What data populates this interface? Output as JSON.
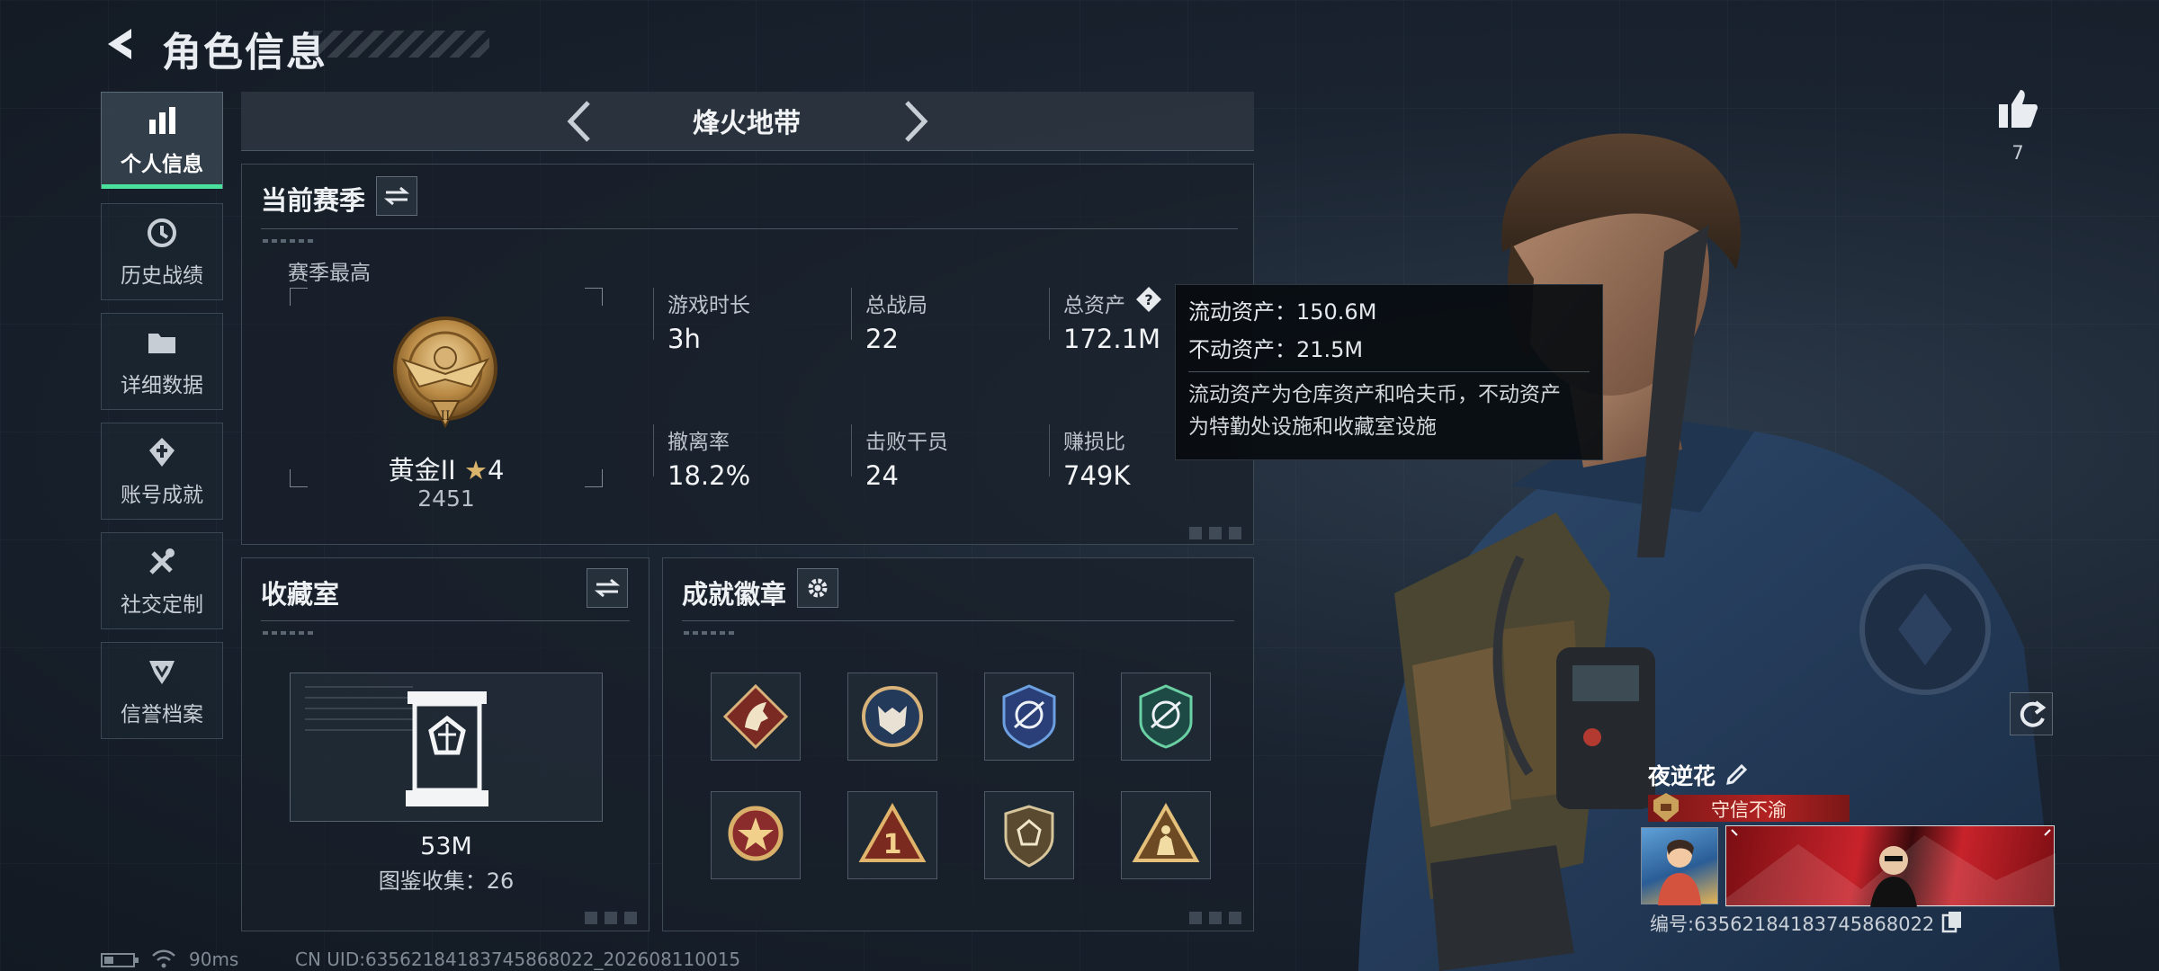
{
  "header": {
    "title": "角色信息"
  },
  "sidebar": {
    "items": [
      {
        "label": "个人信息",
        "icon": "bar-chart-icon"
      },
      {
        "label": "历史战绩",
        "icon": "history-clock-icon"
      },
      {
        "label": "详细数据",
        "icon": "folder-icon"
      },
      {
        "label": "账号成就",
        "icon": "achievement-icon"
      },
      {
        "label": "社交定制",
        "icon": "tools-icon"
      },
      {
        "label": "信誉档案",
        "icon": "credit-icon"
      }
    ]
  },
  "mode": {
    "title": "烽火地带"
  },
  "season": {
    "title": "当前赛季",
    "best_label": "赛季最高",
    "rank_name": "黄金II",
    "rank_stars": "4",
    "rank_score": "2451",
    "stats": [
      {
        "label": "游戏时长",
        "value": "3h"
      },
      {
        "label": "总战局",
        "value": "22"
      },
      {
        "label": "总资产",
        "value": "172.1M"
      },
      {
        "label": "撤离率",
        "value": "18.2%"
      },
      {
        "label": "击败干员",
        "value": "24"
      },
      {
        "label": "赚损比",
        "value": "749K"
      }
    ]
  },
  "tooltip": {
    "liquid": "流动资产：150.6M",
    "fixed": "不动资产：21.5M",
    "desc_line1": "流动资产为仓库资产和哈夫币，不动资产",
    "desc_line2": "为特勤处设施和收藏室设施"
  },
  "collection": {
    "title": "收藏室",
    "value": "53M",
    "catalog": "图鉴收集：26"
  },
  "achievements": {
    "title": "成就徽章",
    "badges": [
      "horse-badge",
      "wolf-badge",
      "crosshair-badge-blue",
      "crosshair-badge-green",
      "star-medal-badge",
      "rank-one-badge",
      "shield-badge",
      "triangle-soldiers-badge"
    ]
  },
  "likes": {
    "count": "7"
  },
  "profile": {
    "name": "夜逆花",
    "title": "守信不渝",
    "uid_label": "编号:63562184183745868022"
  },
  "status": {
    "ping": "90ms",
    "uid": "CN UID:63562184183745868022_202608110015"
  },
  "colors": {
    "accent": "#49e19b",
    "title_red": "#b22222",
    "gold": "#c9a15a"
  }
}
